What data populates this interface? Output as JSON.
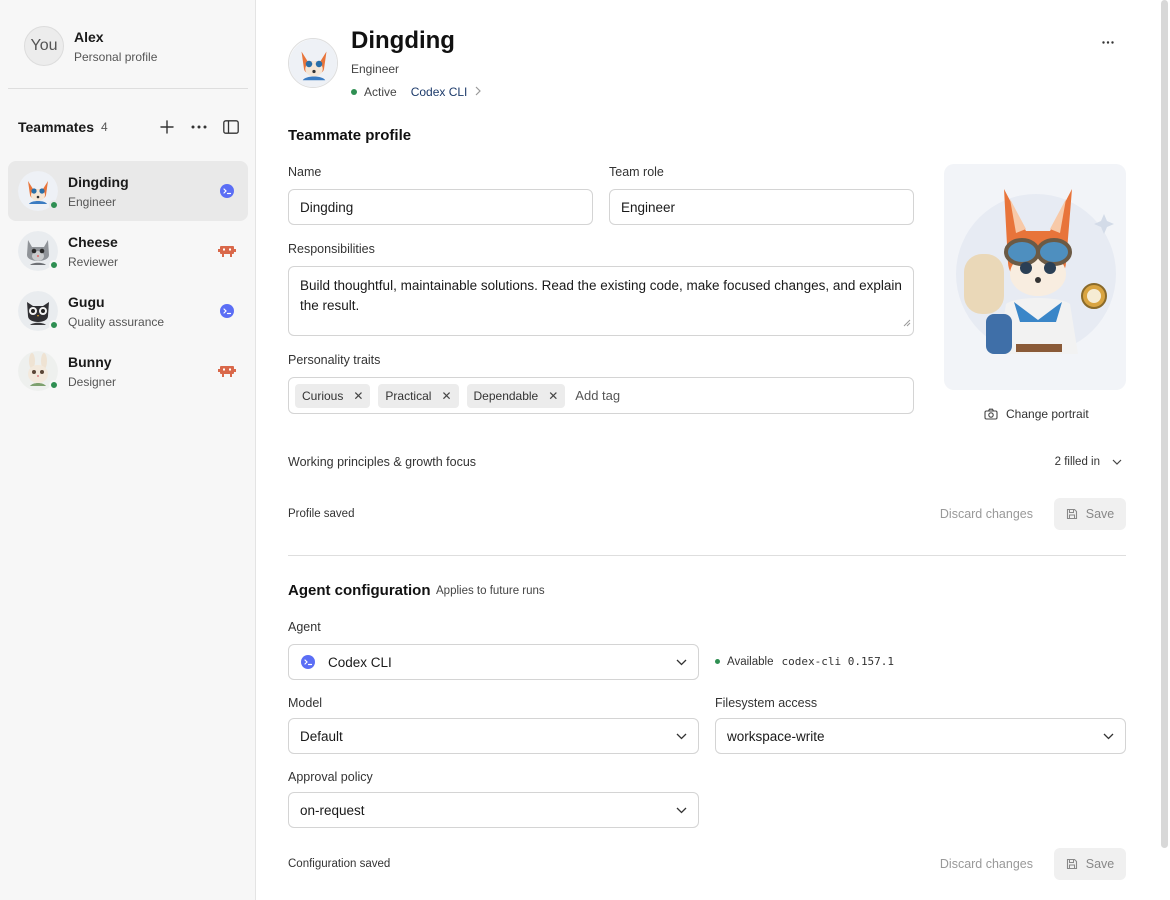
{
  "user": {
    "avatar_text": "You",
    "name": "Alex",
    "subtitle": "Personal profile"
  },
  "sidebar": {
    "title": "Teammates",
    "count": "4",
    "teammates": [
      {
        "name": "Dingding",
        "role": "Engineer",
        "agent": "codex",
        "active": true
      },
      {
        "name": "Cheese",
        "role": "Reviewer",
        "agent": "claude"
      },
      {
        "name": "Gugu",
        "role": "Quality assurance",
        "agent": "codex"
      },
      {
        "name": "Bunny",
        "role": "Designer",
        "agent": "claude"
      }
    ]
  },
  "header": {
    "name": "Dingding",
    "role": "Engineer",
    "status": "Active",
    "agent_link": "Codex CLI"
  },
  "profile": {
    "section_title": "Teammate profile",
    "name_label": "Name",
    "name_value": "Dingding",
    "team_role_label": "Team role",
    "team_role_value": "Engineer",
    "responsibilities_label": "Responsibilities",
    "responsibilities_value": "Build thoughtful, maintainable solutions. Read the existing code, make focused changes, and explain the result.",
    "traits_label": "Personality traits",
    "traits": [
      "Curious",
      "Practical",
      "Dependable"
    ],
    "add_tag_placeholder": "Add tag",
    "change_portrait": "Change portrait",
    "principles_label": "Working principles & growth focus",
    "principles_count": "2 filled in",
    "status": "Profile saved",
    "discard_label": "Discard changes",
    "save_label": "Save"
  },
  "config": {
    "section_title": "Agent configuration",
    "note": "Applies to future runs",
    "agent_label": "Agent",
    "agent_value": "Codex CLI",
    "availability": "Available",
    "version": "codex-cli 0.157.1",
    "model_label": "Model",
    "model_value": "Default",
    "fs_label": "Filesystem access",
    "fs_value": "workspace-write",
    "approval_label": "Approval policy",
    "approval_value": "on-request",
    "status": "Configuration saved",
    "discard_label": "Discard changes",
    "save_label": "Save"
  },
  "colors": {
    "status_green": "#2f8f52",
    "codex_blue": "#5b6ef5",
    "claude_orange": "#d9684a",
    "link_blue": "#1d3b6b"
  }
}
